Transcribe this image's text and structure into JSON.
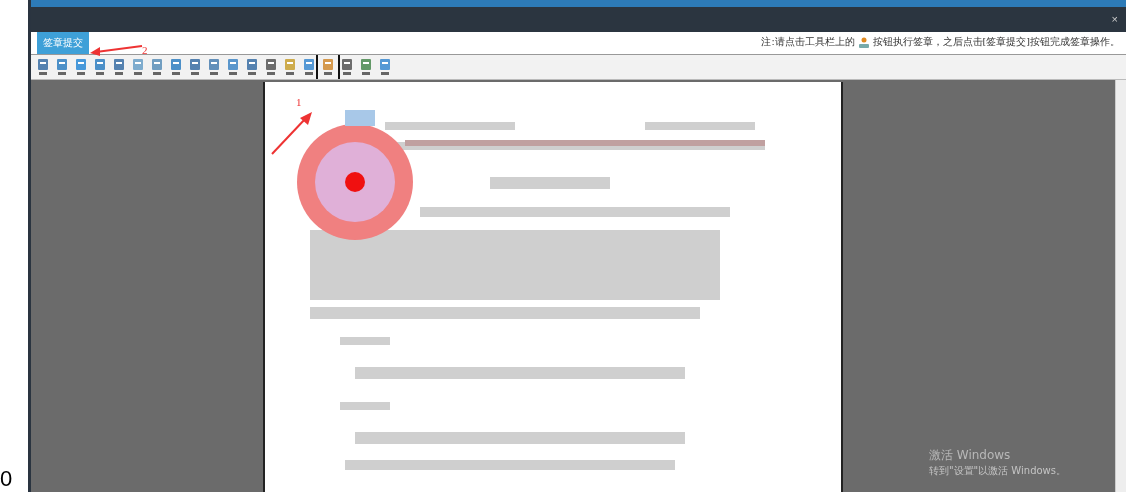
{
  "dialog": {
    "close": "×"
  },
  "submit_button": "签章提交",
  "note": {
    "before": "注:请点击工具栏上的",
    "after": "按钮执行签章，之后点击[签章提交]按钮完成签章操作。"
  },
  "annotations": [
    {
      "label": "2"
    },
    {
      "label": "1"
    }
  ],
  "watermark_os": {
    "title": "激活 Windows",
    "subtitle": "转到\"设置\"以激活 Windows。"
  },
  "corner_text": "0"
}
